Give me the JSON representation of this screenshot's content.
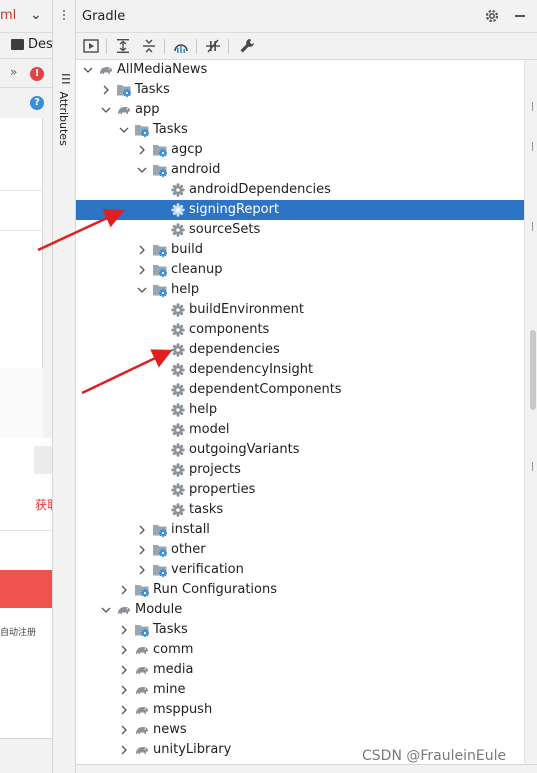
{
  "editor": {
    "tab_label": "ml",
    "design_label": "Design",
    "status_text_red": "获取",
    "small_text": "自动注册"
  },
  "sidebar": {
    "attributes_label": "Attributes"
  },
  "gradle": {
    "title": "Gradle",
    "toolbar": [
      "run-task-icon",
      "expand-all-icon",
      "collapse-all-icon",
      "analyze-icon",
      "offline-mode-icon",
      "settings-wrench-icon"
    ],
    "tree": [
      {
        "label": "AllMediaNews",
        "depth": 0,
        "expander": "open",
        "icon": "elephant"
      },
      {
        "label": "Tasks",
        "depth": 1,
        "expander": "closed",
        "icon": "folder-gear"
      },
      {
        "label": "app",
        "depth": 1,
        "expander": "open",
        "icon": "elephant"
      },
      {
        "label": "Tasks",
        "depth": 2,
        "expander": "open",
        "icon": "folder-gear"
      },
      {
        "label": "agcp",
        "depth": 3,
        "expander": "closed",
        "icon": "folder-gear"
      },
      {
        "label": "android",
        "depth": 3,
        "expander": "open",
        "icon": "folder-gear"
      },
      {
        "label": "androidDependencies",
        "depth": 4,
        "expander": "none",
        "icon": "gear"
      },
      {
        "label": "signingReport",
        "depth": 4,
        "expander": "none",
        "icon": "gear",
        "selected": true
      },
      {
        "label": "sourceSets",
        "depth": 4,
        "expander": "none",
        "icon": "gear"
      },
      {
        "label": "build",
        "depth": 3,
        "expander": "closed",
        "icon": "folder-gear"
      },
      {
        "label": "cleanup",
        "depth": 3,
        "expander": "closed",
        "icon": "folder-gear"
      },
      {
        "label": "help",
        "depth": 3,
        "expander": "open",
        "icon": "folder-gear"
      },
      {
        "label": "buildEnvironment",
        "depth": 4,
        "expander": "none",
        "icon": "gear"
      },
      {
        "label": "components",
        "depth": 4,
        "expander": "none",
        "icon": "gear"
      },
      {
        "label": "dependencies",
        "depth": 4,
        "expander": "none",
        "icon": "gear"
      },
      {
        "label": "dependencyInsight",
        "depth": 4,
        "expander": "none",
        "icon": "gear"
      },
      {
        "label": "dependentComponents",
        "depth": 4,
        "expander": "none",
        "icon": "gear"
      },
      {
        "label": "help",
        "depth": 4,
        "expander": "none",
        "icon": "gear"
      },
      {
        "label": "model",
        "depth": 4,
        "expander": "none",
        "icon": "gear"
      },
      {
        "label": "outgoingVariants",
        "depth": 4,
        "expander": "none",
        "icon": "gear"
      },
      {
        "label": "projects",
        "depth": 4,
        "expander": "none",
        "icon": "gear"
      },
      {
        "label": "properties",
        "depth": 4,
        "expander": "none",
        "icon": "gear"
      },
      {
        "label": "tasks",
        "depth": 4,
        "expander": "none",
        "icon": "gear"
      },
      {
        "label": "install",
        "depth": 3,
        "expander": "closed",
        "icon": "folder-gear"
      },
      {
        "label": "other",
        "depth": 3,
        "expander": "closed",
        "icon": "folder-gear"
      },
      {
        "label": "verification",
        "depth": 3,
        "expander": "closed",
        "icon": "folder-gear"
      },
      {
        "label": "Run Configurations",
        "depth": 2,
        "expander": "closed",
        "icon": "folder-gear"
      },
      {
        "label": "Module",
        "depth": 1,
        "expander": "open",
        "icon": "elephant"
      },
      {
        "label": "Tasks",
        "depth": 2,
        "expander": "closed",
        "icon": "folder-gear"
      },
      {
        "label": "comm",
        "depth": 2,
        "expander": "closed",
        "icon": "elephant"
      },
      {
        "label": "media",
        "depth": 2,
        "expander": "closed",
        "icon": "elephant"
      },
      {
        "label": "mine",
        "depth": 2,
        "expander": "closed",
        "icon": "elephant"
      },
      {
        "label": "msppush",
        "depth": 2,
        "expander": "closed",
        "icon": "elephant"
      },
      {
        "label": "news",
        "depth": 2,
        "expander": "closed",
        "icon": "elephant"
      },
      {
        "label": "unityLibrary",
        "depth": 2,
        "expander": "closed",
        "icon": "elephant"
      }
    ]
  },
  "watermark": "CSDN @FrauleinEule",
  "colors": {
    "selection": "#2d74c4",
    "arrow": "#e02020",
    "gear_blue": "#3a8ed8"
  }
}
